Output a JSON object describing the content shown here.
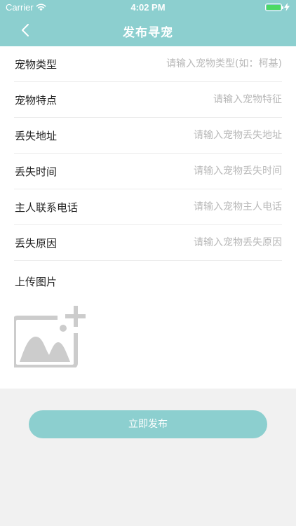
{
  "status_bar": {
    "carrier": "Carrier",
    "time": "4:02 PM"
  },
  "nav": {
    "title": "发布寻宠"
  },
  "form": {
    "fields": [
      {
        "label": "宠物类型",
        "placeholder": "请输入宠物类型(如：柯基)",
        "value": ""
      },
      {
        "label": "宠物特点",
        "placeholder": "请输入宠物特征",
        "value": ""
      },
      {
        "label": "丢失地址",
        "placeholder": "请输入宠物丢失地址",
        "value": ""
      },
      {
        "label": "丢失时间",
        "placeholder": "请输入宠物丢失时间",
        "value": ""
      },
      {
        "label": "主人联系电话",
        "placeholder": "请输入宠物主人电话",
        "value": ""
      },
      {
        "label": "丢失原因",
        "placeholder": "请输入宠物丢失原因",
        "value": ""
      }
    ],
    "upload_label": "上传图片",
    "upload_icon": "add-image-icon"
  },
  "submit_label": "立即发布",
  "colors": {
    "accent": "#8ccfcf",
    "battery": "#4cd964",
    "placeholder": "#b8b8b8",
    "icon_gray": "#cccccc"
  }
}
